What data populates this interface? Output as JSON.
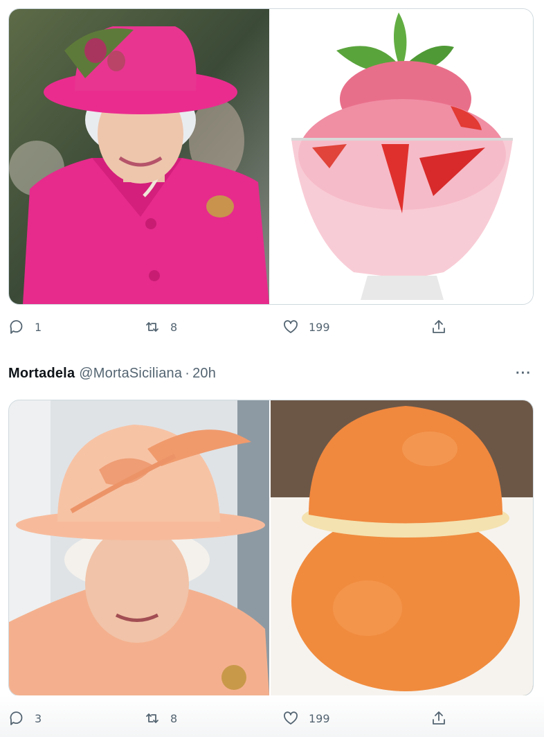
{
  "tweet1": {
    "actions": {
      "reply_count": "1",
      "retweet_count": "8",
      "like_count": "199"
    },
    "icons": [
      "reply-icon",
      "retweet-icon",
      "like-icon",
      "share-icon"
    ]
  },
  "tweet2": {
    "author_name": "Mortadela",
    "author_handle": "@MortaSiciliana",
    "separator": "·",
    "timestamp": "20h",
    "more_label": "···",
    "actions": {
      "reply_count": "3",
      "retweet_count": "8",
      "like_count": "199"
    },
    "icons": [
      "reply-icon",
      "retweet-icon",
      "like-icon",
      "share-icon"
    ]
  },
  "colors": {
    "text_primary": "#0f1419",
    "text_secondary": "#536471",
    "border": "#cfd9de",
    "hot_pink": "#e8238a",
    "peach": "#f6b594",
    "orange": "#f28a3c"
  }
}
